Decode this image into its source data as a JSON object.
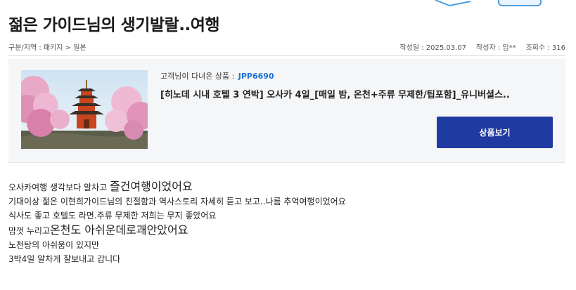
{
  "page": {
    "title": "젊은 가이드님의 생기발랄..여행"
  },
  "meta": {
    "breadcrumb": "구분/지역 : 패키지 > 일본",
    "date_label": "작성일 : 2025.03.07",
    "author_label": "작성자 : 임**",
    "views_label": "조회수 : 316"
  },
  "product": {
    "traveled_label": "고객님이 다녀온 상품 :",
    "code": "JPP6690",
    "name": "[히노데 시내 호텔 3 연박] 오사카 4일_[매일 밤, 온천+주류 무제한/팁포함]_유니버셜스..",
    "view_button": "상품보기",
    "image_icon": "japan-pagoda-cherry-blossom-photo"
  },
  "review": {
    "line1": {
      "pre": " 오사카여행 생각보다 알차고 ",
      "big": "즐건여행이었어요"
    },
    "line2": "기대이상 젊은 이현희가이드님의 친절함과 역사스토리 자세히 듣고 보고..나름 추억여행이었어요",
    "line3": "식사도 좋고 호텔도 라면.주류 무제한 저희는 무지 좋았어요",
    "line4": {
      "pre": "맘껏 누리고",
      "big": "온천도 아쉬운데로괘안았어요"
    },
    "line5": "노천탕의 아쉬움이 있지만",
    "line6": "3박4일 알차게 잘보내고 갑니다"
  },
  "colors": {
    "button_bg": "#1f3aa0",
    "product_code": "#1e6fd9",
    "box_bg": "#f5f6f8"
  }
}
